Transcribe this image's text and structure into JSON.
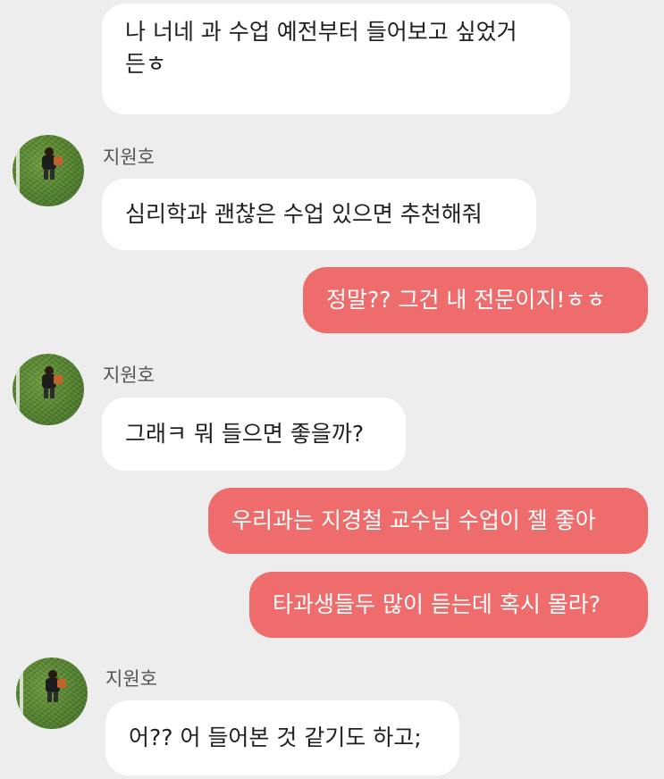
{
  "messages": {
    "m1": "나 너네 과 수업 예전부터 들어보고 싶었거",
    "m1_cont": "든ㅎ",
    "m2": "심리학과 괜찮은 수업 있으면 추천해줘",
    "m3": "정말?? 그건 내 전문이지!ㅎㅎ",
    "m4": "그래ㅋ 뭐 들으면 좋을까?",
    "m5": "우리과는 지경철 교수님 수업이 젤 좋아",
    "m6": "타과생들두 많이 듣는데 혹시 몰라?",
    "m7": "어?? 어 들어본 것 같기도 하고;"
  },
  "sender": {
    "name": "지원호"
  },
  "colors": {
    "background": "#ededed",
    "incoming_bubble": "#ffffff",
    "outgoing_bubble": "#ee6c6b"
  }
}
